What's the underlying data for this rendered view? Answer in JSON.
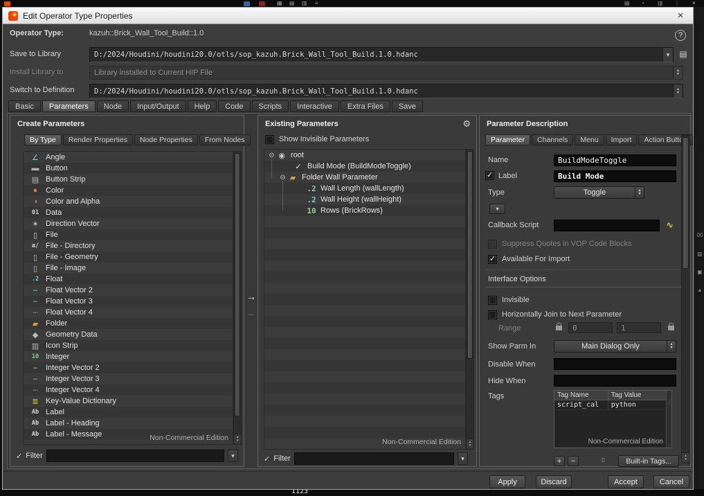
{
  "background": {
    "frame_number": "1123",
    "right_edge_text": "00"
  },
  "window": {
    "title": "Edit Operator Type Properties"
  },
  "icons": {
    "check": "✓",
    "chevron_down": "▾",
    "spin_up": "▴",
    "spin_down": "▾",
    "gear": "⚙",
    "help": "?",
    "close": "×",
    "move_right_arrow": "→",
    "move_left_arrow": "←",
    "filter": "✓",
    "library_file": "▤",
    "script": "∿",
    "grip_dots": "⠿",
    "grip_vdots": "⋮"
  },
  "header": {
    "operator_type": {
      "label": "Operator Type:",
      "value": "kazuh::Brick_Wall_Tool_Build::1.0"
    },
    "save_to_library": {
      "label": "Save to Library",
      "value": "D:/2024/Houdini/houdini20.0/otls/sop_kazuh.Brick_Wall_Tool_Build.1.0.hdanc"
    },
    "install_library_to": {
      "label": "Install Library to",
      "value": "Library installed to Current HIP File"
    },
    "switch_to_definition": {
      "label": "Switch to Definition",
      "value": "D:/2024/Houdini/houdini20.0/otls/sop_kazuh.Brick_Wall_Tool_Build.1.0.hdanc"
    }
  },
  "main_tabs": [
    {
      "label": "Basic",
      "active": false
    },
    {
      "label": "Parameters",
      "active": true
    },
    {
      "label": "Node",
      "active": false
    },
    {
      "label": "Input/Output",
      "active": false
    },
    {
      "label": "Help",
      "active": false
    },
    {
      "label": "Code",
      "active": false
    },
    {
      "label": "Scripts",
      "active": false
    },
    {
      "label": "Interactive",
      "active": false
    },
    {
      "label": "Extra Files",
      "active": false
    },
    {
      "label": "Save",
      "active": false
    }
  ],
  "create_parameters": {
    "title": "Create Parameters",
    "tabs": [
      {
        "label": "By Type",
        "active": true
      },
      {
        "label": "Render Properties",
        "active": false
      },
      {
        "label": "Node Properties",
        "active": false
      },
      {
        "label": "From Nodes",
        "active": false
      }
    ],
    "items": [
      {
        "label": "Angle",
        "icon": "angle-icon",
        "glyph": "∠",
        "color": "#7ecfcf"
      },
      {
        "label": "Button",
        "icon": "button-icon",
        "glyph": "▬",
        "color": "#b5b5b5"
      },
      {
        "label": "Button Strip",
        "icon": "button-strip-icon",
        "glyph": "▤",
        "color": "#b5b5b5"
      },
      {
        "label": "Color",
        "icon": "color-icon",
        "glyph": "●",
        "color": "#d07a4a"
      },
      {
        "label": "Color and Alpha",
        "icon": "color-alpha-icon",
        "glyph": "◑",
        "color": "#d07a4a"
      },
      {
        "label": "Data",
        "icon": "data-icon",
        "glyph": "01",
        "color": "#cfcfcf",
        "text_icon": true
      },
      {
        "label": "Direction Vector",
        "icon": "direction-vector-icon",
        "glyph": "✶",
        "color": "#c9c9c9"
      },
      {
        "label": "File",
        "icon": "file-icon",
        "glyph": "▯",
        "color": "#d8d8d8"
      },
      {
        "label": "File - Directory",
        "icon": "file-directory-icon",
        "glyph": "a/",
        "color": "#d8d8d8",
        "text_icon": true
      },
      {
        "label": "File - Geometry",
        "icon": "file-geometry-icon",
        "glyph": "▯",
        "color": "#a8d0a0"
      },
      {
        "label": "File - Image",
        "icon": "file-image-icon",
        "glyph": "▯",
        "color": "#d0bc7a"
      },
      {
        "label": "Float",
        "icon": "float-icon",
        "glyph": ".2",
        "color": "#7ecfcf",
        "text_icon": true
      },
      {
        "label": "Float Vector 2",
        "icon": "float-vector2-icon",
        "glyph": "╌",
        "color": "#7ecfcf"
      },
      {
        "label": "Float Vector 3",
        "icon": "float-vector3-icon",
        "glyph": "┄",
        "color": "#7ecfcf"
      },
      {
        "label": "Float Vector 4",
        "icon": "float-vector4-icon",
        "glyph": "┈",
        "color": "#7ecfcf"
      },
      {
        "label": "Folder",
        "icon": "folder-icon",
        "glyph": "▰",
        "color": "#d2a23c"
      },
      {
        "label": "Geometry Data",
        "icon": "geometry-data-icon",
        "glyph": "◆",
        "color": "#bcbcbc"
      },
      {
        "label": "Icon Strip",
        "icon": "icon-strip-icon",
        "glyph": "▥",
        "color": "#b5b5b5"
      },
      {
        "label": "Integer",
        "icon": "integer-icon",
        "glyph": "10",
        "color": "#8ecf8e",
        "text_icon": true
      },
      {
        "label": "Integer Vector 2",
        "icon": "integer-vector2-icon",
        "glyph": "╌",
        "color": "#8ecf8e"
      },
      {
        "label": "Integer Vector 3",
        "icon": "integer-vector3-icon",
        "glyph": "┄",
        "color": "#8ecf8e"
      },
      {
        "label": "Integer Vector 4",
        "icon": "integer-vector4-icon",
        "glyph": "┈",
        "color": "#8ecf8e"
      },
      {
        "label": "Key-Value Dictionary",
        "icon": "key-value-dictionary-icon",
        "glyph": "≣",
        "color": "#cfc87e"
      },
      {
        "label": "Label",
        "icon": "label-icon",
        "glyph": "Ab",
        "color": "#d8d8d8",
        "text_icon": true
      },
      {
        "label": "Label - Heading",
        "icon": "label-heading-icon",
        "glyph": "Ab",
        "color": "#d8d8d8",
        "text_icon": true
      },
      {
        "label": "Label - Message",
        "icon": "label-message-icon",
        "glyph": "Ab",
        "color": "#d8d8d8",
        "text_icon": true
      }
    ],
    "watermark": "Non-Commercial Edition",
    "filter": {
      "label": "Filter",
      "value": ""
    }
  },
  "existing_parameters": {
    "title": "Existing Parameters",
    "show_invisible_label": "Show Invisible Parameters",
    "tree": [
      {
        "expander": "⊖",
        "icon": "root-icon",
        "glyph": "◉",
        "color": "#c8c8c8",
        "label": "root",
        "pad": "4px"
      },
      {
        "expander": "",
        "icon": "toggle-parameter-icon",
        "glyph": "✓",
        "color": "#ececec",
        "label": "Build Mode (BuildModeToggle)",
        "pad": "28px"
      },
      {
        "expander": "⊖",
        "icon": "folder-parameter-icon",
        "glyph": "▰",
        "color": "#d2a23c",
        "label": "Folder Wall Parameter",
        "pad": "20px"
      },
      {
        "expander": "",
        "icon": "float-parameter-icon",
        "glyph": ".2",
        "color": "#7ecfcf",
        "label": "Wall Length (wallLength)",
        "pad": "47px",
        "text_icon": true
      },
      {
        "expander": "",
        "icon": "float-parameter-icon",
        "glyph": ".2",
        "color": "#7ecfcf",
        "label": "Wall Height (wallHeight)",
        "pad": "47px",
        "text_icon": true
      },
      {
        "expander": "",
        "icon": "integer-parameter-icon",
        "glyph": "10",
        "color": "#8ecf8e",
        "label": "Rows (BrickRows)",
        "pad": "47px",
        "text_icon": true
      }
    ],
    "watermark": "Non-Commercial Edition",
    "filter": {
      "label": "Filter",
      "value": ""
    }
  },
  "parameter_description": {
    "title": "Parameter Description",
    "tabs": [
      {
        "label": "Parameter",
        "active": true
      },
      {
        "label": "Channels",
        "active": false
      },
      {
        "label": "Menu",
        "active": false
      },
      {
        "label": "Import",
        "active": false
      },
      {
        "label": "Action Button",
        "active": false
      }
    ],
    "name": {
      "label": "Name",
      "value": "BuildModeToggle"
    },
    "label": {
      "label": "Label",
      "value": "Build Mode",
      "checked": true
    },
    "type": {
      "label": "Type",
      "value": "Toggle"
    },
    "callback_script": {
      "label": "Callback Script",
      "value": ""
    },
    "suppress_quotes": {
      "label": "Suppress Quotes in VOP Code Blocks",
      "checked": false,
      "disabled": true
    },
    "available_for_import": {
      "label": "Available For Import",
      "checked": true
    },
    "interface_options_title": "Interface Options",
    "invisible": {
      "label": "Invisible",
      "checked": false
    },
    "horizontal_join": {
      "label": "Horizontally Join to Next Parameter",
      "checked": false
    },
    "range": {
      "label": "Range",
      "min": "0",
      "max": "1"
    },
    "show_parm_in": {
      "label": "Show Parm In",
      "value": "Main Dialog Only"
    },
    "disable_when": {
      "label": "Disable When",
      "value": ""
    },
    "hide_when": {
      "label": "Hide When",
      "value": ""
    },
    "tags": {
      "label": "Tags",
      "headers": [
        "Tag Name",
        "Tag Value"
      ],
      "rows": [
        {
          "name": "script_cal",
          "value": "python"
        }
      ],
      "watermark": "Non-Commercial Edition"
    },
    "add_button": "+",
    "remove_button": "−",
    "builtin_tags_button": "Built-in Tags..."
  },
  "footer": {
    "apply": "Apply",
    "discard": "Discard",
    "accept": "Accept",
    "cancel": "Cancel"
  }
}
